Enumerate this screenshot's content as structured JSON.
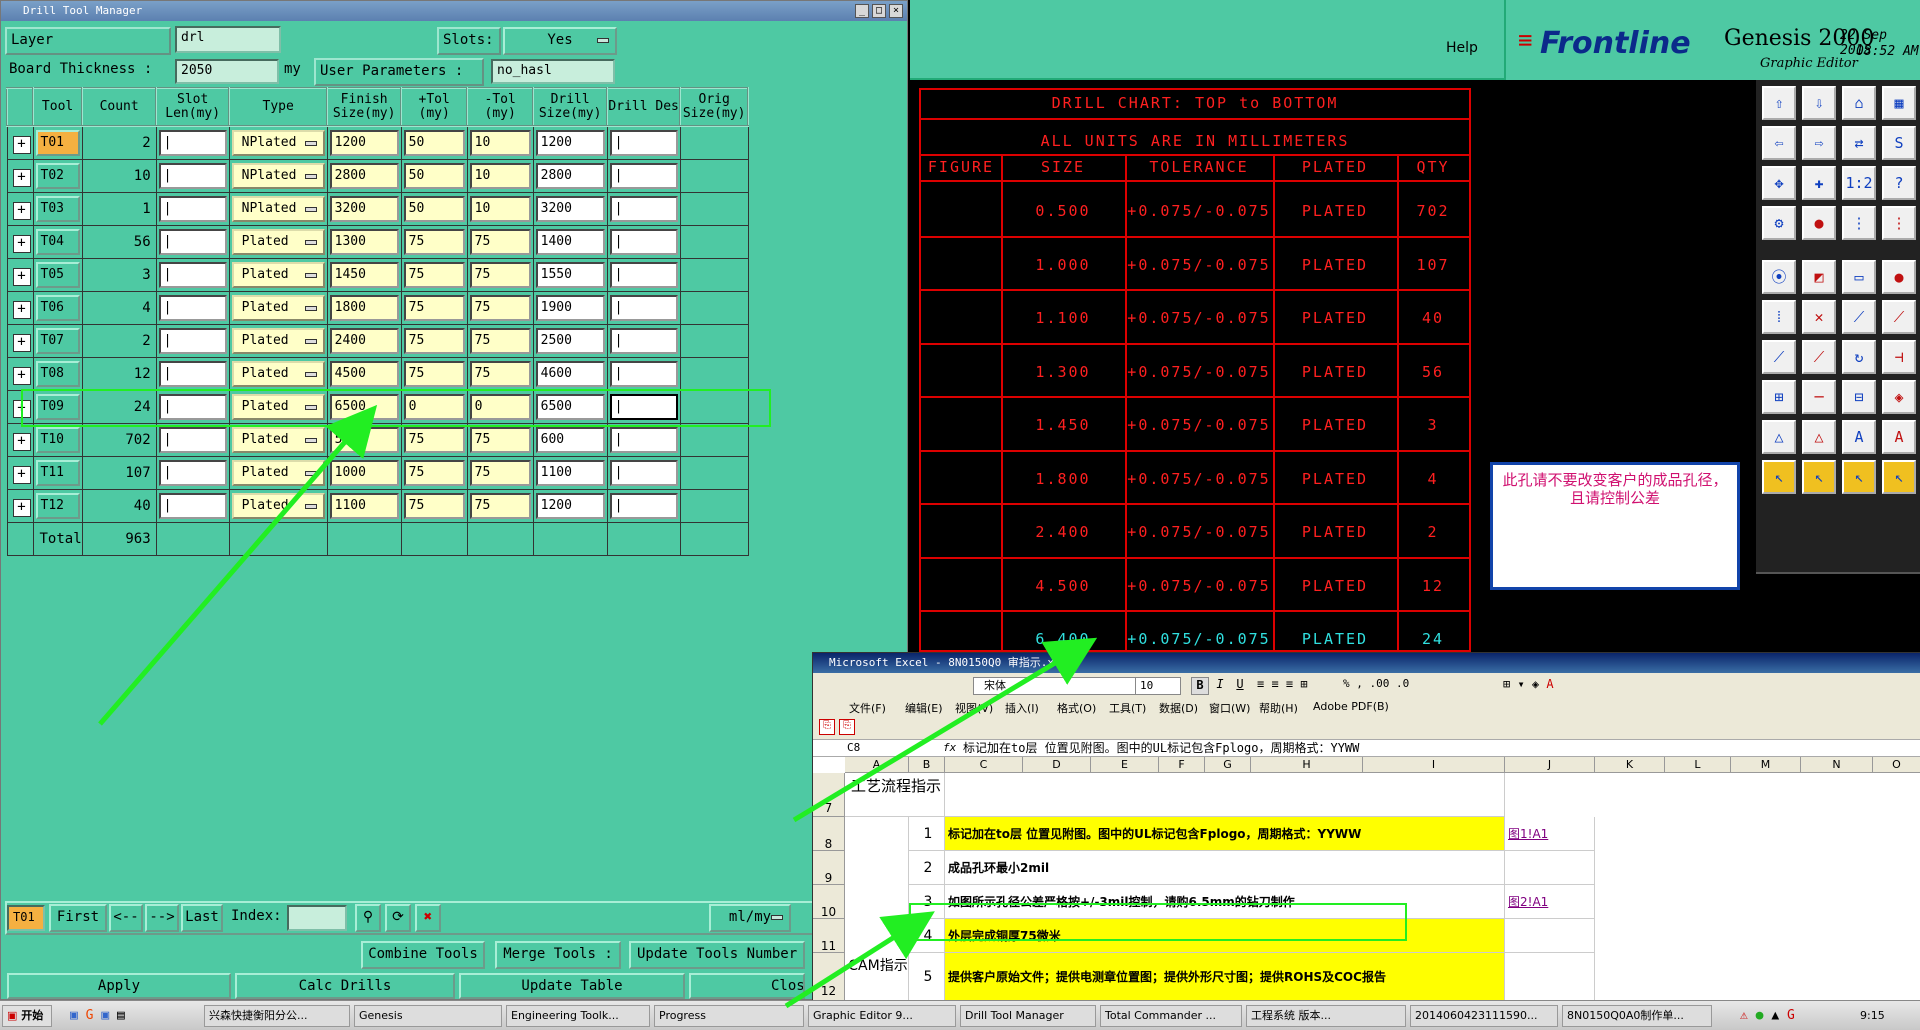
{
  "dtm": {
    "title": "Drill Tool Manager",
    "layer_label": "Layer",
    "layer_value": "drl",
    "slots_label": "Slots:",
    "slots_value": "Yes",
    "thickness_label": "Board Thickness :",
    "thickness_value": "2050",
    "thickness_unit": "my",
    "user_params_label": "User Parameters :",
    "user_params_value": "no_hasl",
    "headers": [
      "Tool",
      "Count",
      "Slot Len(my)",
      "Type",
      "Finish Size(my)",
      "+Tol (my)",
      "-Tol (my)",
      "Drill Size(my)",
      "Drill Des",
      "Orig Size(my)"
    ],
    "rows": [
      {
        "tool": "T01",
        "count": "2",
        "type": "NPlated",
        "finish": "1200",
        "ptol": "50",
        "mtol": "10",
        "drill": "1200"
      },
      {
        "tool": "T02",
        "count": "10",
        "type": "NPlated",
        "finish": "2800",
        "ptol": "50",
        "mtol": "10",
        "drill": "2800"
      },
      {
        "tool": "T03",
        "count": "1",
        "type": "NPlated",
        "finish": "3200",
        "ptol": "50",
        "mtol": "10",
        "drill": "3200"
      },
      {
        "tool": "T04",
        "count": "56",
        "type": "Plated",
        "finish": "1300",
        "ptol": "75",
        "mtol": "75",
        "drill": "1400"
      },
      {
        "tool": "T05",
        "count": "3",
        "type": "Plated",
        "finish": "1450",
        "ptol": "75",
        "mtol": "75",
        "drill": "1550"
      },
      {
        "tool": "T06",
        "count": "4",
        "type": "Plated",
        "finish": "1800",
        "ptol": "75",
        "mtol": "75",
        "drill": "1900"
      },
      {
        "tool": "T07",
        "count": "2",
        "type": "Plated",
        "finish": "2400",
        "ptol": "75",
        "mtol": "75",
        "drill": "2500"
      },
      {
        "tool": "T08",
        "count": "12",
        "type": "Plated",
        "finish": "4500",
        "ptol": "75",
        "mtol": "75",
        "drill": "4600"
      },
      {
        "tool": "T09",
        "count": "24",
        "type": "Plated",
        "finish": "6500",
        "ptol": "0",
        "mtol": "0",
        "drill": "6500"
      },
      {
        "tool": "T10",
        "count": "702",
        "type": "Plated",
        "finish": "500",
        "ptol": "75",
        "mtol": "75",
        "drill": "600"
      },
      {
        "tool": "T11",
        "count": "107",
        "type": "Plated",
        "finish": "1000",
        "ptol": "75",
        "mtol": "75",
        "drill": "1100"
      },
      {
        "tool": "T12",
        "count": "40",
        "type": "Plated",
        "finish": "1100",
        "ptol": "75",
        "mtol": "75",
        "drill": "1200"
      }
    ],
    "total_label": "Total",
    "total_value": "963",
    "nav": {
      "current": "T01",
      "first": "First",
      "prev": "<--",
      "next": "-->",
      "last": "Last",
      "index": "Index:",
      "units": "ml/my"
    },
    "combine": "Combine Tools",
    "merge": "Merge Tools :",
    "update_num": "Update Tools Number",
    "apply": "Apply",
    "calc": "Calc Drills",
    "update_table": "Update Table",
    "close": "Close"
  },
  "genesis": {
    "help": "Help",
    "brand": "Frontline",
    "product": "Genesis 2000",
    "subtitle": "Graphic Editor",
    "date": "22 Sep 2015",
    "time": "08:52 AM"
  },
  "drill_chart": {
    "title": "DRILL CHART: TOP to BOTTOM",
    "units": "ALL UNITS ARE IN MILLIMETERS",
    "headers": [
      "FIGURE",
      "SIZE",
      "TOLERANCE",
      "PLATED",
      "QTY"
    ],
    "rows": [
      {
        "size": "0.500",
        "tol": "+0.075/-0.075",
        "plated": "PLATED",
        "qty": "702"
      },
      {
        "size": "1.000",
        "tol": "+0.075/-0.075",
        "plated": "PLATED",
        "qty": "107"
      },
      {
        "size": "1.100",
        "tol": "+0.075/-0.075",
        "plated": "PLATED",
        "qty": "40"
      },
      {
        "size": "1.300",
        "tol": "+0.075/-0.075",
        "plated": "PLATED",
        "qty": "56"
      },
      {
        "size": "1.450",
        "tol": "+0.075/-0.075",
        "plated": "PLATED",
        "qty": "3"
      },
      {
        "size": "1.800",
        "tol": "+0.075/-0.075",
        "plated": "PLATED",
        "qty": "4"
      },
      {
        "size": "2.400",
        "tol": "+0.075/-0.075",
        "plated": "PLATED",
        "qty": "2"
      },
      {
        "size": "4.500",
        "tol": "+0.075/-0.075",
        "plated": "PLATED",
        "qty": "12"
      },
      {
        "size": "6.400",
        "tol": "+0.075/-0.075",
        "plated": "PLATED",
        "qty": "24"
      }
    ]
  },
  "note": "此孔请不要改变客户的成品孔径，且请控制公差",
  "excel": {
    "title": "Microsoft Excel - 8N0150Q0 审指示.xls",
    "font": "宋体",
    "size": "10",
    "menu": [
      "文件(F)",
      "编辑(E)",
      "视图(V)",
      "插入(I)",
      "格式(O)",
      "工具(T)",
      "数据(D)",
      "窗口(W)",
      "帮助(H)",
      "Adobe PDF(B)"
    ],
    "cellref": "C8",
    "fx": "fx",
    "formula": "标记加在to层 位置见附图。图中的UL标记包含Fplogo，周期格式：YYWW",
    "cols": [
      "A",
      "B",
      "C",
      "D",
      "E",
      "F",
      "G",
      "H",
      "I",
      "J",
      "K",
      "L",
      "M",
      "N",
      "O"
    ],
    "row_nums": [
      "7",
      "8",
      "9",
      "10",
      "11",
      "12"
    ],
    "process_label": "工艺流程指示",
    "cam_label": "CAM指示",
    "items": [
      {
        "n": "1",
        "text": "标记加在to层 位置见附图。图中的UL标记包含Fplogo，周期格式：YYWW",
        "link": "图1!A1"
      },
      {
        "n": "2",
        "text": "成品孔环最小2mil",
        "link": ""
      },
      {
        "n": "3",
        "text": "如图所示孔径公差严格按+/-3mil控制，请购6.5mm的钻刀制作",
        "link": "图2!A1"
      },
      {
        "n": "4",
        "text": "外层完成铜厚75微米",
        "link": ""
      },
      {
        "n": "5",
        "text": "提供客户原始文件；提供电测章位置图；提供外形尺寸图；提供ROHS及COC报告",
        "link": ""
      }
    ]
  },
  "taskbar": {
    "start": "开始",
    "items": [
      "兴森快捷衡阳分公...",
      "Genesis",
      "Engineering Toolk...",
      "Progress",
      "Graphic Editor 9...",
      "Drill Tool Manager",
      "Total Commander ...",
      "工程系统  版本...",
      "2014060423111590...",
      "8N0150Q0A0制作单..."
    ],
    "clock": "9:15"
  }
}
